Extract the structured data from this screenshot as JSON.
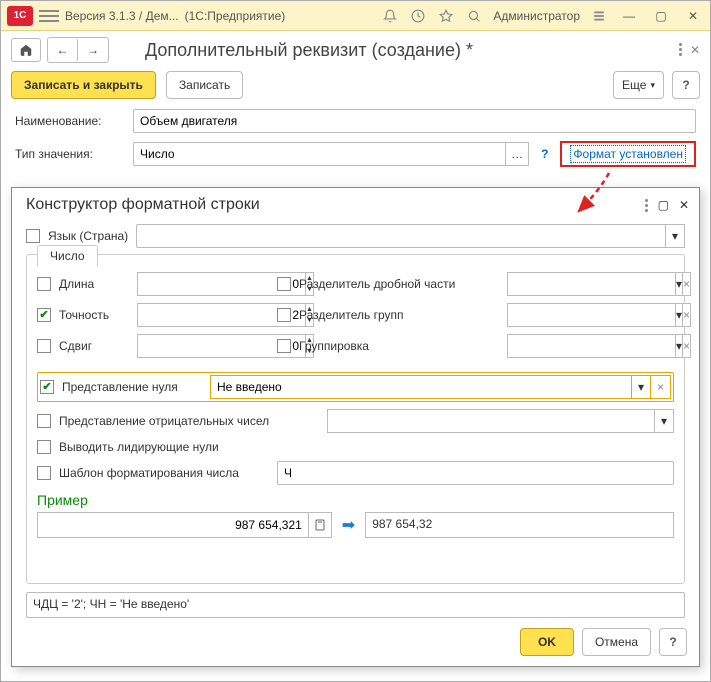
{
  "titlebar": {
    "version": "Версия 3.1.3 / Дем...",
    "platform": "(1С:Предприятие)",
    "user": "Администратор"
  },
  "page": {
    "title": "Дополнительный реквизит (создание) *",
    "save_close": "Записать и закрыть",
    "save": "Записать",
    "more": "Еще"
  },
  "fields": {
    "name_label": "Наименование:",
    "name_value": "Объем двигателя",
    "type_label": "Тип значения:",
    "type_value": "Число",
    "format_link": "Формат установлен"
  },
  "dialog": {
    "title": "Конструктор форматной строки",
    "lang_label": "Язык (Страна)",
    "tab": "Число",
    "length_label": "Длина",
    "length_value": "0",
    "precision_label": "Точность",
    "precision_value": "2",
    "shift_label": "Сдвиг",
    "shift_value": "0",
    "fraction_sep_label": "Разделитель дробной части",
    "group_sep_label": "Разделитель групп",
    "grouping_label": "Группировка",
    "zero_rep_label": "Представление нуля",
    "zero_rep_value": "Не введено",
    "neg_rep_label": "Представление отрицательных чисел",
    "leading_zeros_label": "Выводить лидирующие нули",
    "template_label": "Шаблон форматирования числа",
    "template_value": "Ч",
    "example_label": "Пример",
    "example_in": "987 654,321",
    "example_out": "987 654,32",
    "result": "ЧДЦ = '2'; ЧН = 'Не введено'",
    "ok": "OK",
    "cancel": "Отмена"
  }
}
